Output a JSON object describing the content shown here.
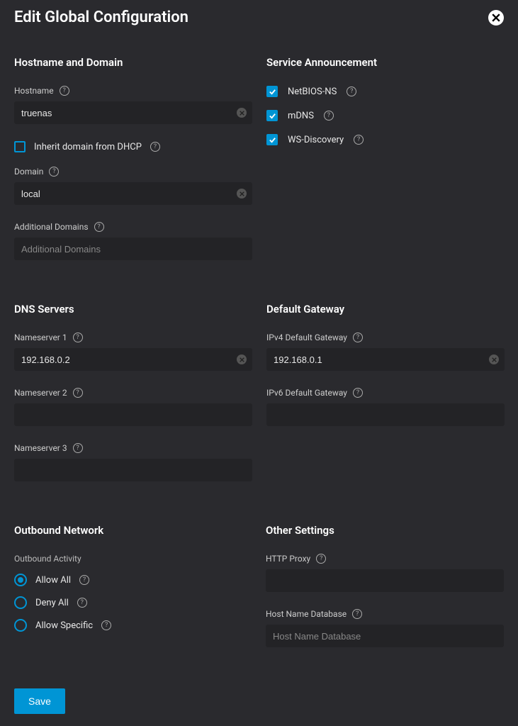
{
  "header": {
    "title": "Edit Global Configuration"
  },
  "hostname_domain": {
    "title": "Hostname and Domain",
    "hostname_label": "Hostname",
    "hostname_value": "truenas",
    "inherit_label": "Inherit domain from DHCP",
    "inherit_checked": false,
    "domain_label": "Domain",
    "domain_value": "local",
    "additional_label": "Additional Domains",
    "additional_placeholder": "Additional Domains",
    "additional_value": ""
  },
  "service_announcement": {
    "title": "Service Announcement",
    "items": [
      {
        "label": "NetBIOS-NS",
        "checked": true
      },
      {
        "label": "mDNS",
        "checked": true
      },
      {
        "label": "WS-Discovery",
        "checked": true
      }
    ]
  },
  "dns_servers": {
    "title": "DNS Servers",
    "ns1_label": "Nameserver 1",
    "ns1_value": "192.168.0.2",
    "ns2_label": "Nameserver 2",
    "ns2_value": "",
    "ns3_label": "Nameserver 3",
    "ns3_value": ""
  },
  "default_gateway": {
    "title": "Default Gateway",
    "ipv4_label": "IPv4 Default Gateway",
    "ipv4_value": "192.168.0.1",
    "ipv6_label": "IPv6 Default Gateway",
    "ipv6_value": ""
  },
  "outbound": {
    "title": "Outbound Network",
    "activity_label": "Outbound Activity",
    "options": [
      {
        "label": "Allow All",
        "checked": true
      },
      {
        "label": "Deny All",
        "checked": false
      },
      {
        "label": "Allow Specific",
        "checked": false
      }
    ]
  },
  "other": {
    "title": "Other Settings",
    "proxy_label": "HTTP Proxy",
    "proxy_value": "",
    "hostdb_label": "Host Name Database",
    "hostdb_placeholder": "Host Name Database",
    "hostdb_value": ""
  },
  "footer": {
    "save_label": "Save"
  }
}
